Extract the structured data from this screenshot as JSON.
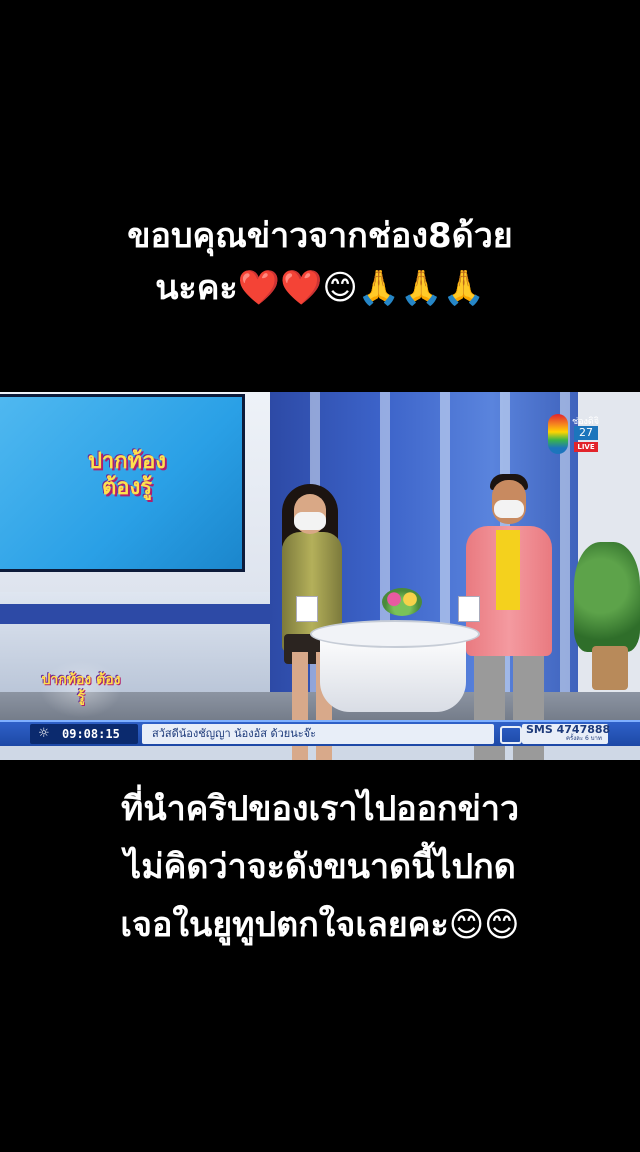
{
  "caption_top": {
    "line1": "ขอบคุณข่าวจากช่อง8ด้วย",
    "line2": "นะคะ❤️❤️😊🙏🙏🙏"
  },
  "video": {
    "screen_logo": "ปากท้อง ต้องรู้",
    "show_logo": "ปากท้อง ต้องรู้",
    "channel": {
      "top_text": "ช่องดิจิ",
      "number": "27",
      "live": "LIVE"
    },
    "ticker": {
      "weather_icon": "☼",
      "time": "09:08:15",
      "message": "สวัสดีน้องชัญญา น้องอัส ด้วยนะจ๊ะ",
      "sms_label": "SMS 4747888",
      "sms_sub": "ครั้งละ 6 บาท"
    }
  },
  "caption_bottom": {
    "line1": "ที่นำคริปของเราไปออกข่าว",
    "line2": "ไม่คิดว่าจะดังขนาดนี้ไปกด",
    "line3": "เจอในยูทูปตกใจเลยคะ😊😊"
  },
  "colors": {
    "background": "#000000",
    "caption_text": "#ffffff",
    "ticker_blue": "#1d48a6"
  }
}
